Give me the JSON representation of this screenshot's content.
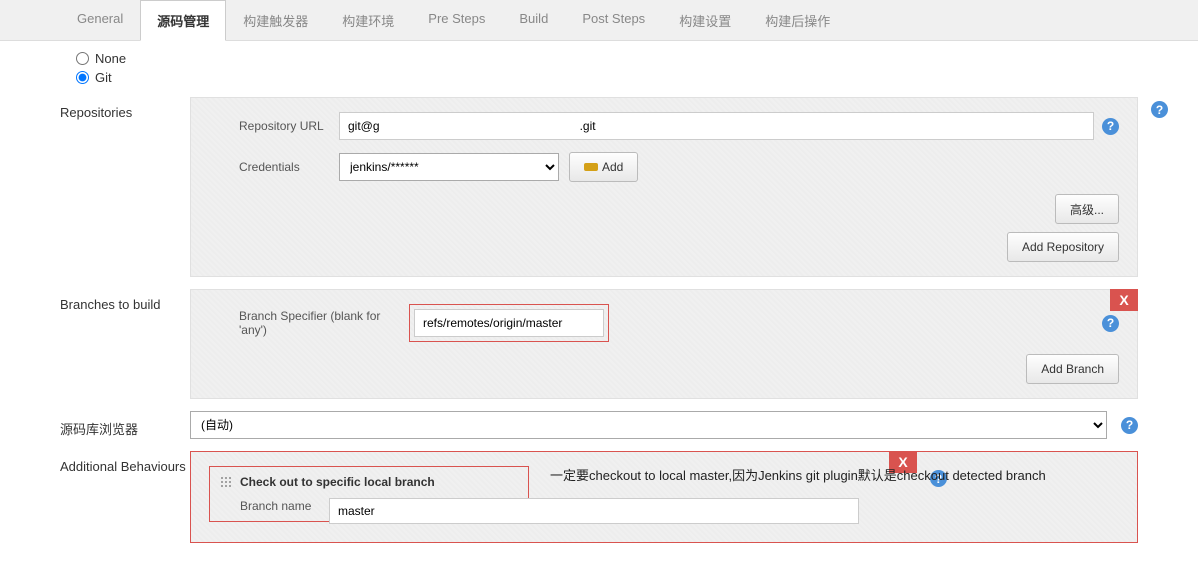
{
  "tabs": {
    "general": "General",
    "scm": "源码管理",
    "triggers": "构建触发器",
    "env": "构建环境",
    "pre": "Pre Steps",
    "build": "Build",
    "post": "Post Steps",
    "settings": "构建设置",
    "postbuild": "构建后操作"
  },
  "scm": {
    "none_label": "None",
    "git_label": "Git"
  },
  "repositories": {
    "label": "Repositories",
    "repo_url_label": "Repository URL",
    "repo_url_value": "git@g                                                            .git",
    "credentials_label": "Credentials",
    "credentials_value": "jenkins/******",
    "add_btn": "Add",
    "advanced_btn": "高级...",
    "add_repo_btn": "Add Repository"
  },
  "branches": {
    "label": "Branches to build",
    "specifier_label": "Branch Specifier (blank for 'any')",
    "specifier_value": "refs/remotes/origin/master",
    "add_branch_btn": "Add Branch",
    "close_x": "X"
  },
  "browser": {
    "label": "源码库浏览器",
    "value": "(自动)"
  },
  "behaviours": {
    "label": "Additional Behaviours",
    "checkout_title": "Check out to specific local branch",
    "branch_name_label": "Branch name",
    "branch_name_value": "master",
    "close_x": "X"
  },
  "annotation": "一定要checkout to local master,因为Jenkins git plugin默认是checkout detected branch"
}
